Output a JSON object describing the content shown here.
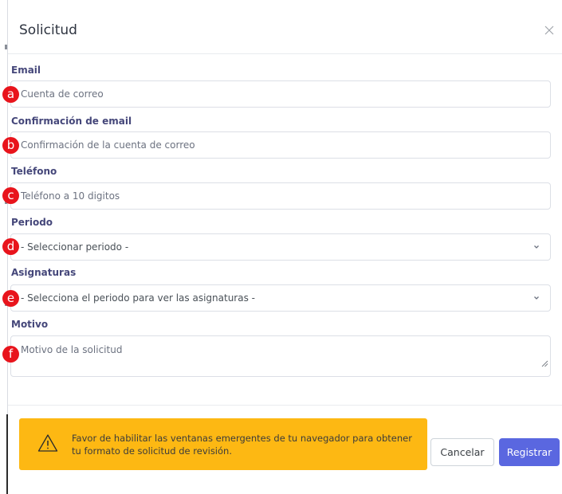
{
  "modal": {
    "title": "Solicitud",
    "close_icon": "close-icon"
  },
  "form": {
    "email": {
      "label": "Email",
      "placeholder": "Cuenta de correo",
      "marker": "a"
    },
    "email_confirm": {
      "label": "Confirmación de email",
      "placeholder": "Confirmación de la cuenta de correo",
      "marker": "b"
    },
    "phone": {
      "label": "Teléfono",
      "placeholder": "Teléfono a 10 digitos",
      "marker": "c"
    },
    "period": {
      "label": "Periodo",
      "selected": "- Seleccionar periodo -",
      "marker": "d"
    },
    "subjects": {
      "label": "Asignaturas",
      "selected": "- Selecciona el periodo para ver las asignaturas -",
      "marker": "e"
    },
    "reason": {
      "label": "Motivo",
      "placeholder": "Motivo de la solicitud",
      "marker": "f"
    }
  },
  "alert": {
    "icon": "warning-icon",
    "text": "Favor de habilitar las ventanas emergentes de tu navegador para obtener tu formato de solicitud de revisión.",
    "color": "#fdb813"
  },
  "buttons": {
    "cancel": "Cancelar",
    "submit": "Registrar",
    "primary_color": "#5a67e0"
  },
  "marker_color": "#e8141c"
}
